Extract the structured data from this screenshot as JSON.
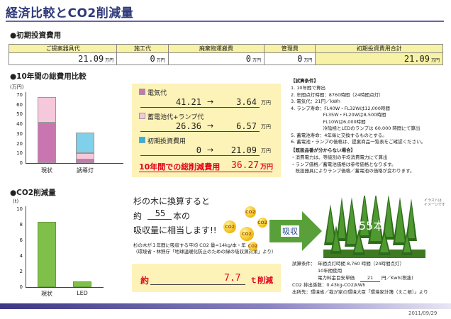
{
  "title": "経済比較とCO2削減量",
  "initial_cost": {
    "section": "●初期投資費用",
    "headers": [
      "ご提案器具代",
      "施工代",
      "廃棄物運搬費",
      "管理費",
      "初期投資費用合計"
    ],
    "values": [
      "21.09",
      "0",
      "0",
      "0",
      "21.09"
    ],
    "unit": "万円"
  },
  "cost_chart": {
    "section": "●10年間の総費用比較",
    "unit_label": "(万円)",
    "ticks": [
      "70",
      "60",
      "50",
      "40",
      "30",
      "20",
      "10",
      "0"
    ]
  },
  "chart_data": [
    {
      "type": "bar",
      "stacked": true,
      "categories": [
        "現状",
        "誘導灯"
      ],
      "series": [
        {
          "name": "電気代",
          "values": [
            41.21,
            3.64
          ],
          "color": "#c976b0"
        },
        {
          "name": "蓄電池代+ランプ代",
          "values": [
            26.36,
            6.57
          ],
          "color": "#f6c8db"
        },
        {
          "name": "初期投資費用",
          "values": [
            0,
            21.09
          ],
          "color": "#7fd0ea"
        }
      ],
      "ylim": [
        0,
        70
      ],
      "ylabel": "(万円)"
    },
    {
      "type": "bar",
      "categories": [
        "現状",
        "LED"
      ],
      "values": [
        8.4,
        0.7
      ],
      "color": "#7fc04a",
      "ylim": [
        0,
        10
      ],
      "ylabel": "(t)"
    }
  ],
  "comparison": {
    "rows": [
      {
        "label": "電気代",
        "before": "41.21",
        "after": "3.64",
        "unit": "万円",
        "color": "#c976b0"
      },
      {
        "label": "蓄電池代+ランプ代",
        "before": "26.36",
        "after": "6.57",
        "unit": "万円",
        "color": "#f6c8db"
      },
      {
        "label": "初期投資費用",
        "before": "0",
        "after": "21.09",
        "unit": "万円",
        "color": "#2fb3e0"
      }
    ],
    "arrow": "→",
    "total_label": "10年間での総削減費用",
    "total_value": "36.27",
    "total_unit": "万円"
  },
  "conditions": {
    "title": "【試算条件】",
    "lines": [
      "1. 10年間で算出",
      "2. 年間点灯時間：8760時間（24時間点灯）",
      "3. 電気代：21円／kWh",
      "4. ランプ寿命：FL40W・FL32Wは12,000時間",
      "　　　　　　　FL35W・FL20Wは8,500時間",
      "　　　　　　　FL10Wは6,000時間",
      "　　　　　　　冷陰極とLEDのランプは 60,000 時間にて算出",
      "5. 蓄電池寿命：4年毎に交換するものとする。",
      "6. 蓄電池・ランプの価格は、提案商品一覧表をご確認ください。"
    ],
    "note_title": "【既設品番が分からない場合】",
    "note_lines": [
      "・消費電力は、等級別の平均消費電力にて算出",
      "・ランプ価格／蓄電池価格は参考価格となります。",
      "　既設器具によりランプ価格／蓄電池の価格が変わります。"
    ]
  },
  "co2_chart": {
    "section": "●CO2削減量",
    "unit_label": "(t)",
    "ticks": [
      "10",
      "8",
      "6",
      "4",
      "2",
      "0"
    ]
  },
  "cedar": {
    "line1": "杉の木に換算すると",
    "prefix": "約",
    "count": "55",
    "suffix": "本の",
    "line3": "吸収量に相当します!!",
    "footnote1": "杉の木が１年間に吸収する平均 CO2 量=14kg/本・年",
    "footnote2": "（環境省・林野庁「地球温暖化防止のための緑の吸収源対策」より）",
    "coin_label": "CO2",
    "arrow_label": "吸収",
    "trees_label": "55本",
    "illustration_note": "イラストは\nイメージです"
  },
  "reduction": {
    "prefix": "約",
    "value": "7.7",
    "unit": "ｔ削減"
  },
  "co2_conditions": {
    "label": "試算条件：",
    "line1": "年間点灯時間 8,760 時間（24時間点灯）",
    "line2": "10年間使用",
    "line3_pre": "電力料金目安単価",
    "line3_val": "21",
    "line3_post": "円／Kwh(税抜)",
    "line4": "CO2 排出係数：0.43kg-CO2/kWh",
    "line5": "出所先：環境省／我が家の環境大臣「環境家計簿（えこ帳）」より"
  },
  "date": "2011/09/29"
}
